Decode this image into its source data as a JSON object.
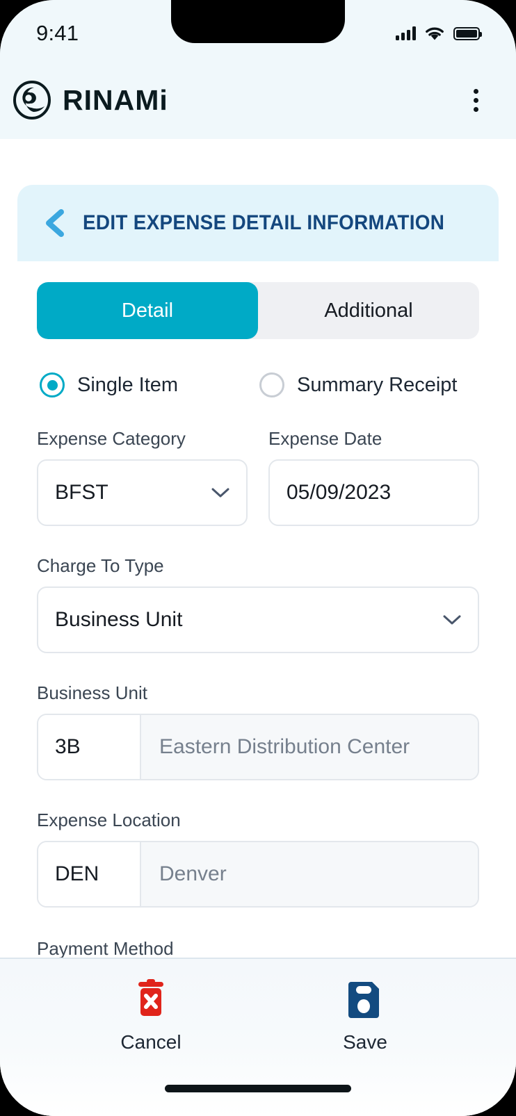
{
  "status_bar": {
    "time": "9:41",
    "icons": [
      "cellular-signal-icon",
      "wifi-icon",
      "battery-icon"
    ]
  },
  "app_bar": {
    "logo_icon": "rinami-logo-icon",
    "brand": "RINAMi",
    "menu_icon": "kebab-menu-icon"
  },
  "card_header": {
    "back_icon": "back-chevron-icon",
    "title": "EDIT EXPENSE DETAIL INFORMATION"
  },
  "tabs": [
    {
      "label": "Detail",
      "active": true
    },
    {
      "label": "Additional",
      "active": false
    }
  ],
  "receipt_type": {
    "options": [
      {
        "label": "Single Item",
        "selected": true
      },
      {
        "label": "Summary Receipt",
        "selected": false
      }
    ]
  },
  "form": {
    "expense_category": {
      "label": "Expense Category",
      "value": "BFST",
      "icon": "chevron-down-icon"
    },
    "expense_date": {
      "label": "Expense Date",
      "value": "05/09/2023"
    },
    "charge_to_type": {
      "label": "Charge To Type",
      "value": "Business Unit",
      "icon": "chevron-down-icon"
    },
    "business_unit": {
      "label": "Business Unit",
      "code": "3B",
      "description": "Eastern Distribution Center"
    },
    "expense_location": {
      "label": "Expense Location",
      "code": "DEN",
      "description": "Denver"
    },
    "payment_method": {
      "label": "Payment Method"
    }
  },
  "actions": [
    {
      "label": "Cancel",
      "icon": "trash-delete-icon",
      "color": "#E0241B"
    },
    {
      "label": "Save",
      "icon": "floppy-save-icon",
      "color": "#134B80"
    }
  ],
  "colors": {
    "accent_teal": "#00AAC6",
    "title_navy": "#14477E",
    "header_cyan": "#E2F4FB",
    "appbar_cyan": "#F0F8FB",
    "cancel_red": "#E0241B",
    "save_navy": "#134B80"
  }
}
